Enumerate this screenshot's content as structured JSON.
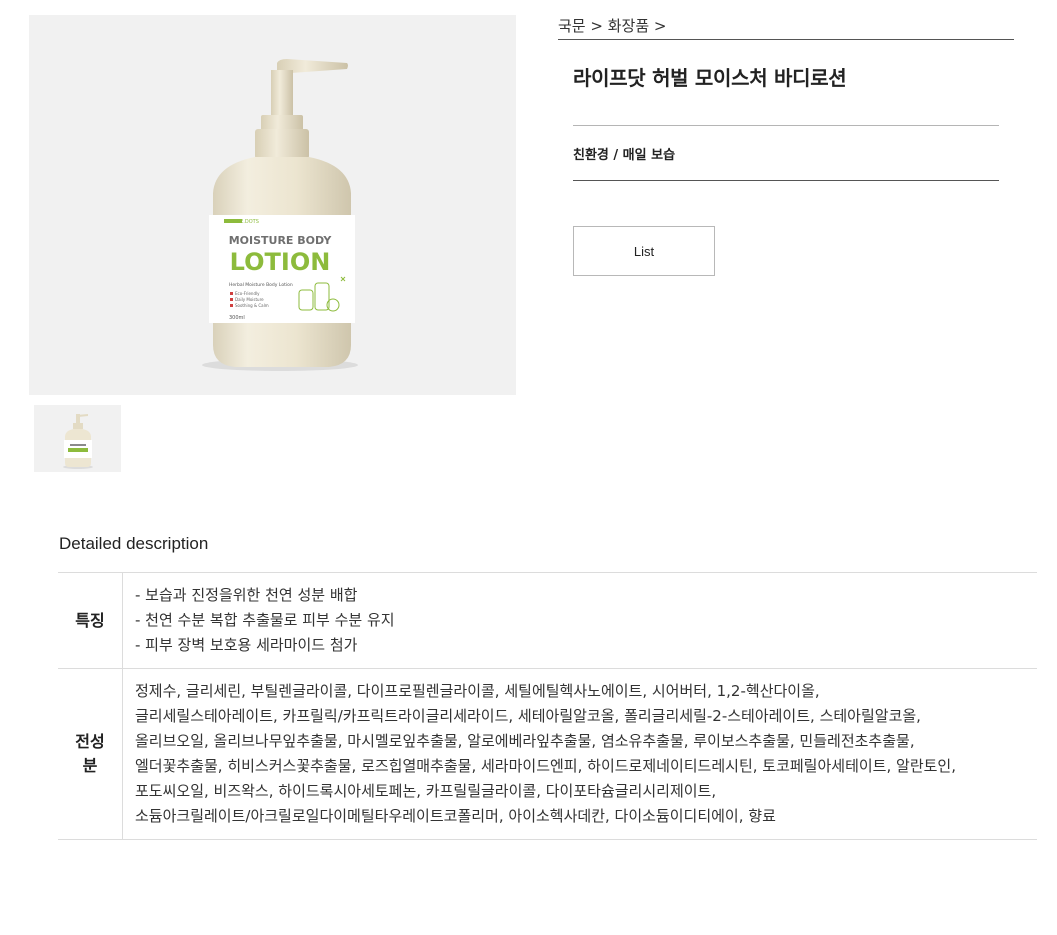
{
  "breadcrumb": {
    "item1": "국문",
    "sep1": " > ",
    "item2": "화장품",
    "sep2": " >"
  },
  "product": {
    "title": "라이프닷 허벌 모이스처 바디로션",
    "tagline": "친환경 / 매일 보습",
    "list_button": "List",
    "image_label": {
      "brand": "LIFE.DOTS",
      "heading": "MOISTURE BODY",
      "big": "LOTION",
      "sub": "Herbal Moisture Body Lotion",
      "bullets": [
        "Eco-Friendly",
        "Daily Moisture",
        "Soothing & Calm"
      ],
      "volume": "300ml"
    }
  },
  "description": {
    "title": "Detailed description",
    "features_label": "특징",
    "features": [
      "- 보습과 진정을위한 천연 성분 배합",
      "- 천연 수분 복합 추출물로 피부 수분 유지",
      "- 피부 장벽 보호용 세라마이드 첨가"
    ],
    "ingredients_label": "전성분",
    "ingredients": [
      "정제수, 글리세린, 부틸렌글라이콜, 다이프로필렌글라이콜, 세틸에틸헥사노에이트, 시어버터, 1,2-헥산다이올,",
      "글리세릴스테아레이트, 카프릴릭/카프릭트라이글리세라이드, 세테아릴알코올, 폴리글리세릴-2-스테아레이트, 스테아릴알코올,",
      "올리브오일, 올리브나무잎추출물, 마시멜로잎추출물, 알로에베라잎추출물, 염소유추출물, 루이보스추출물, 민들레전초추출물,",
      "엘더꽃추출물, 히비스커스꽃추출물, 로즈힙열매추출물, 세라마이드엔피, 하이드로제네이티드레시틴, 토코페릴아세테이트, 알란토인,",
      "포도씨오일, 비즈왁스, 하이드록시아세토페논, 카프릴릴글라이콜, 다이포타슘글리시리제이트,",
      "소듐아크릴레이트/아크릴로일다이메틸타우레이트코폴리머, 아이소헥사데칸, 다이소듐이디티에이, 향료"
    ]
  },
  "colors": {
    "accent_green": "#8dbb3c",
    "bottle": "#ede6d2",
    "image_bg": "#f1f1f1"
  }
}
